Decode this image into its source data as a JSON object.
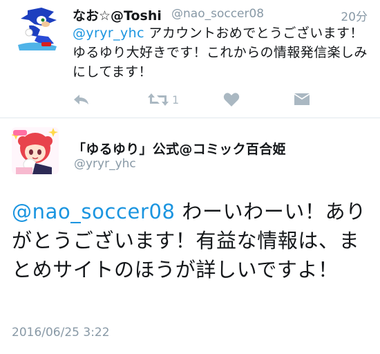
{
  "tweet1": {
    "display_name": "なお☆@Toshi",
    "handle": "@nao_soccer08",
    "time": "20分",
    "mention": "@yryr_yhc",
    "text": " アカウントおめでとうございます！ゆるゆり大好きです！これからの情報発信楽しみにしてます！",
    "retweet_count": "1",
    "icons": [
      "reply-icon",
      "retweet-icon",
      "like-icon",
      "message-icon"
    ]
  },
  "tweet2": {
    "display_name": "「ゆるゆり」公式@コミック百合姫",
    "handle": "@yryr_yhc",
    "mention": "@nao_soccer08",
    "text": " わーいわーい！ありがとうございます！有益な情報は、まとめサイトのほうが詳しいですよ！",
    "date": "2016/06/25 3:22"
  },
  "colors": {
    "mention": "#1b95e0",
    "muted": "#8899a6",
    "icon": "#aab8c2",
    "divider": "#e1e8ed"
  }
}
